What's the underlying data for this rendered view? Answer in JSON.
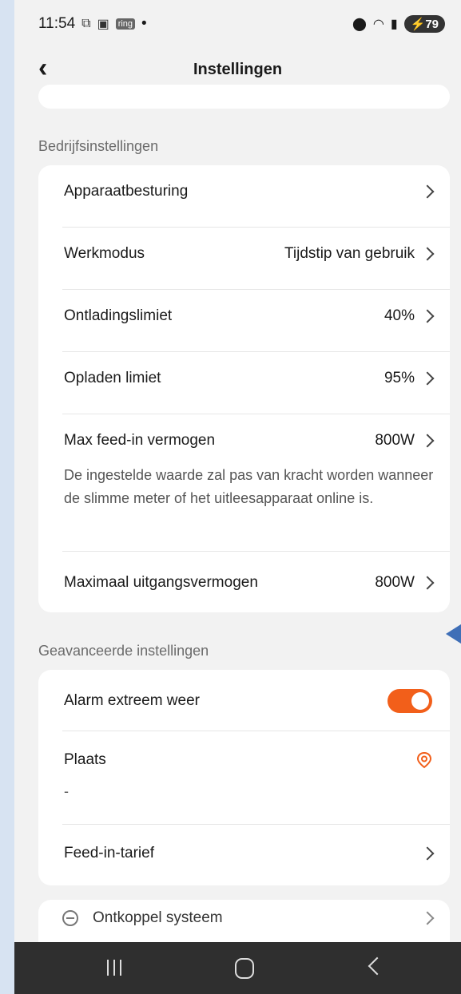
{
  "status_bar": {
    "time": "11:54",
    "ring_badge": "ring",
    "dot": "•",
    "battery": "79",
    "icons": [
      "screenshot-icon",
      "cast-icon",
      "location-icon",
      "wifi-icon",
      "signal-icon"
    ]
  },
  "header": {
    "title": "Instellingen",
    "back_icon": "chevron-left-icon"
  },
  "company_settings": {
    "label": "Bedrijfsinstellingen",
    "items": [
      {
        "label": "Apparaatbesturing",
        "value": ""
      },
      {
        "label": "Werkmodus",
        "value": "Tijdstip van gebruik"
      },
      {
        "label": "Ontladingslimiet",
        "value": "40%"
      },
      {
        "label": "Opladen limiet",
        "value": "95%"
      },
      {
        "label": "Max feed-in vermogen",
        "value": "800W",
        "note": "De ingestelde waarde zal pas van kracht worden wanneer de slimme meter of het uitleesapparaat online is."
      },
      {
        "label": "Maximaal uitgangsvermogen",
        "value": "800W"
      }
    ]
  },
  "advanced_settings": {
    "label": "Geavanceerde instellingen",
    "alarm": {
      "label": "Alarm extreem weer",
      "enabled": true
    },
    "place": {
      "label": "Plaats",
      "value": "-",
      "icon": "location-pin-icon"
    },
    "feed_in_tariff": {
      "label": "Feed-in-tarief"
    }
  },
  "disconnect": {
    "label": "Ontkoppel systeem"
  },
  "colors": {
    "accent": "#f25f1a",
    "annotation_arrow": "#3f6fb7"
  }
}
